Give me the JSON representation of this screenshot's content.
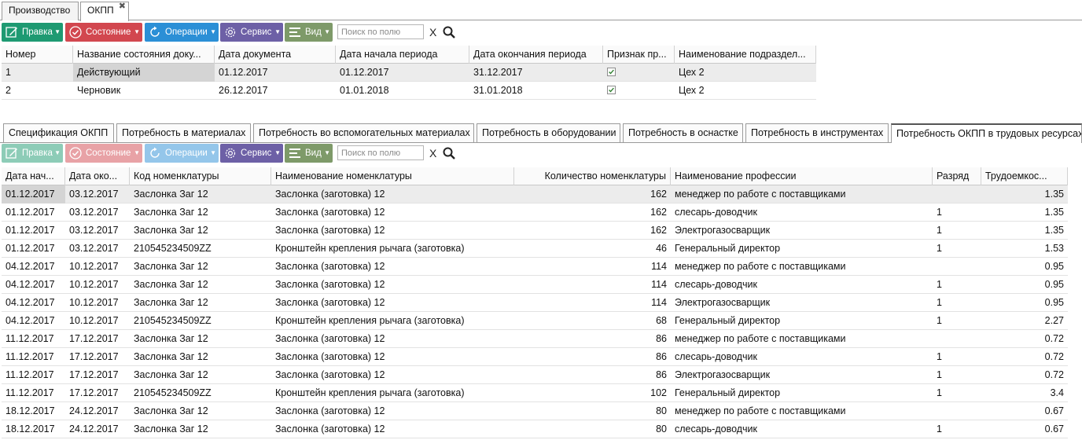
{
  "top_tabs": [
    "Производство",
    "ОКПП"
  ],
  "close_glyph": "✖",
  "toolbar": {
    "buttons": [
      "Правка",
      "Состояние",
      "Операции",
      "Сервис",
      "Вид"
    ],
    "search_placeholder": "Поиск по полю",
    "clear_label": "X"
  },
  "master": {
    "columns": [
      "Номер",
      "Название состояния доку...",
      "Дата документа",
      "Дата начала периода",
      "Дата окончания периода",
      "Признак пр...",
      "Наименование подраздел..."
    ],
    "rows": [
      {
        "num": "1",
        "state": "Действующий",
        "doc_date": "01.12.2017",
        "start": "01.12.2017",
        "end": "31.12.2017",
        "flag": true,
        "dept": "Цех 2"
      },
      {
        "num": "2",
        "state": "Черновик",
        "doc_date": "26.12.2017",
        "start": "01.01.2018",
        "end": "31.01.2018",
        "flag": true,
        "dept": "Цех 2"
      }
    ]
  },
  "detail_tabs": [
    "Спецификация ОКПП",
    "Потребность в материалах",
    "Потребность во вспомогательных материалах",
    "Потребность в оборудовании",
    "Потребность в оснастке",
    "Потребность в инструментах",
    "Потребность ОКПП в трудовых ресурсах"
  ],
  "detail": {
    "columns": [
      "Дата нач...",
      "Дата око...",
      "Код номенклатуры",
      "Наименование номенклатуры",
      "Количество номенклатуры",
      "Наименование профессии",
      "Разряд",
      "Трудоемкос..."
    ],
    "rows": [
      [
        "01.12.2017",
        "03.12.2017",
        "Заслонка Заг 12",
        "Заслонка (заготовка) 12",
        "162",
        "менеджер по работе с поставщиками",
        "",
        "1.35"
      ],
      [
        "01.12.2017",
        "03.12.2017",
        "Заслонка Заг 12",
        "Заслонка (заготовка) 12",
        "162",
        "слесарь-доводчик",
        "1",
        "1.35"
      ],
      [
        "01.12.2017",
        "03.12.2017",
        "Заслонка Заг 12",
        "Заслонка (заготовка) 12",
        "162",
        "Электрогазосварщик",
        "1",
        "1.35"
      ],
      [
        "01.12.2017",
        "03.12.2017",
        "210545234509ZZ",
        "Кронштейн крепления рычага (заготовка)",
        "46",
        "Генеральный директор",
        "1",
        "1.53"
      ],
      [
        "04.12.2017",
        "10.12.2017",
        "Заслонка Заг 12",
        "Заслонка (заготовка) 12",
        "114",
        "менеджер по работе с поставщиками",
        "",
        "0.95"
      ],
      [
        "04.12.2017",
        "10.12.2017",
        "Заслонка Заг 12",
        "Заслонка (заготовка) 12",
        "114",
        "слесарь-доводчик",
        "1",
        "0.95"
      ],
      [
        "04.12.2017",
        "10.12.2017",
        "Заслонка Заг 12",
        "Заслонка (заготовка) 12",
        "114",
        "Электрогазосварщик",
        "1",
        "0.95"
      ],
      [
        "04.12.2017",
        "10.12.2017",
        "210545234509ZZ",
        "Кронштейн крепления рычага (заготовка)",
        "68",
        "Генеральный директор",
        "1",
        "2.27"
      ],
      [
        "11.12.2017",
        "17.12.2017",
        "Заслонка Заг 12",
        "Заслонка (заготовка) 12",
        "86",
        "менеджер по работе с поставщиками",
        "",
        "0.72"
      ],
      [
        "11.12.2017",
        "17.12.2017",
        "Заслонка Заг 12",
        "Заслонка (заготовка) 12",
        "86",
        "слесарь-доводчик",
        "1",
        "0.72"
      ],
      [
        "11.12.2017",
        "17.12.2017",
        "Заслонка Заг 12",
        "Заслонка (заготовка) 12",
        "86",
        "Электрогазосварщик",
        "1",
        "0.72"
      ],
      [
        "11.12.2017",
        "17.12.2017",
        "210545234509ZZ",
        "Кронштейн крепления рычага (заготовка)",
        "102",
        "Генеральный директор",
        "1",
        "3.4"
      ],
      [
        "18.12.2017",
        "24.12.2017",
        "Заслонка Заг 12",
        "Заслонка (заготовка) 12",
        "80",
        "менеджер по работе с поставщиками",
        "",
        "0.67"
      ],
      [
        "18.12.2017",
        "24.12.2017",
        "Заслонка Заг 12",
        "Заслонка (заготовка) 12",
        "80",
        "слесарь-доводчик",
        "1",
        "0.67"
      ]
    ]
  },
  "colors": {
    "edit": "#1e9a72",
    "state": "#d2474f",
    "ops": "#2b8fd6",
    "service": "#6d60a6",
    "view": "#7e9a69"
  }
}
